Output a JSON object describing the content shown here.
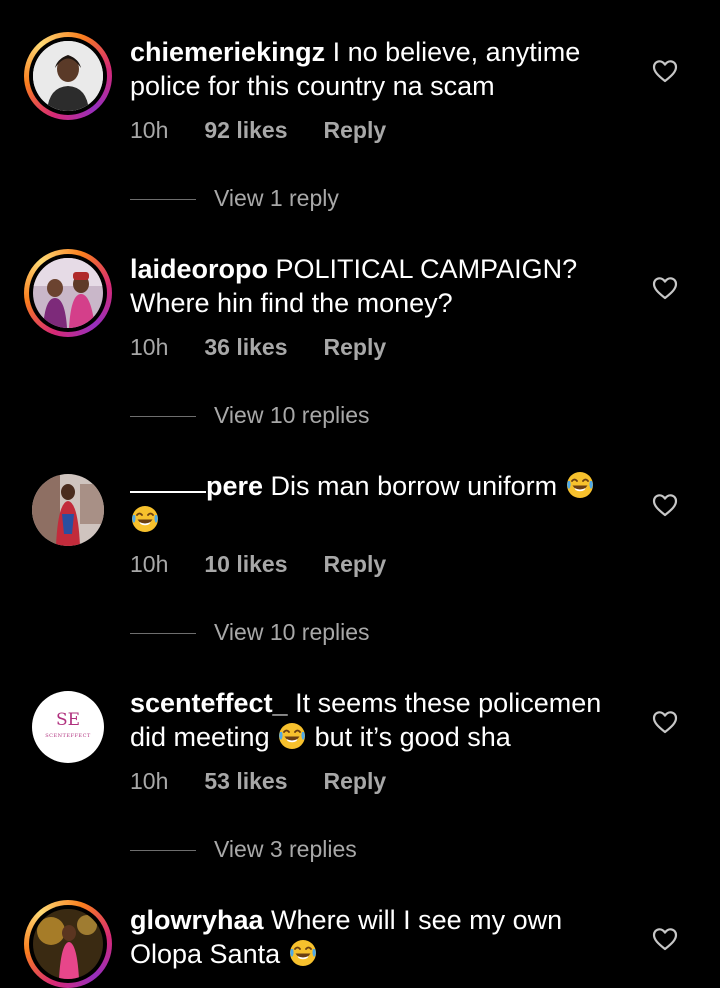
{
  "comments": [
    {
      "username": "chiemeriekingz",
      "text": " I no believe, anytime police for this country na scam",
      "time": "10h",
      "likes": "92 likes",
      "reply": "Reply",
      "view_replies": "View 1 reply"
    },
    {
      "username": "laideoropo",
      "text": " POLITICAL CAMPAIGN? Where hin find the money?",
      "time": "10h",
      "likes": "36 likes",
      "reply": "Reply",
      "view_replies": "View 10 replies"
    },
    {
      "username": "pere",
      "text_before": " Dis man borrow uniform ",
      "time": "10h",
      "likes": "10 likes",
      "reply": "Reply",
      "view_replies": "View 10 replies"
    },
    {
      "username": "scenteffect_",
      "text_before": " It seems these policemen did meeting ",
      "text_after": " but it’s good sha",
      "avatar_logo_mark": "SE",
      "avatar_logo_text": "SCENTEFFECT",
      "time": "10h",
      "likes": "53 likes",
      "reply": "Reply",
      "view_replies": "View 3 replies"
    },
    {
      "username": "glowryhaa",
      "text_before": " Where will I see my own Olopa Santa ",
      "time": "",
      "likes": "",
      "reply": ""
    }
  ],
  "icons": {
    "heart": "heart-outline-icon",
    "emoji": "face-with-tears-of-joy-emoji"
  },
  "colors": {
    "background": "#000000",
    "text": "#ffffff",
    "meta": "#a8a8a8"
  }
}
